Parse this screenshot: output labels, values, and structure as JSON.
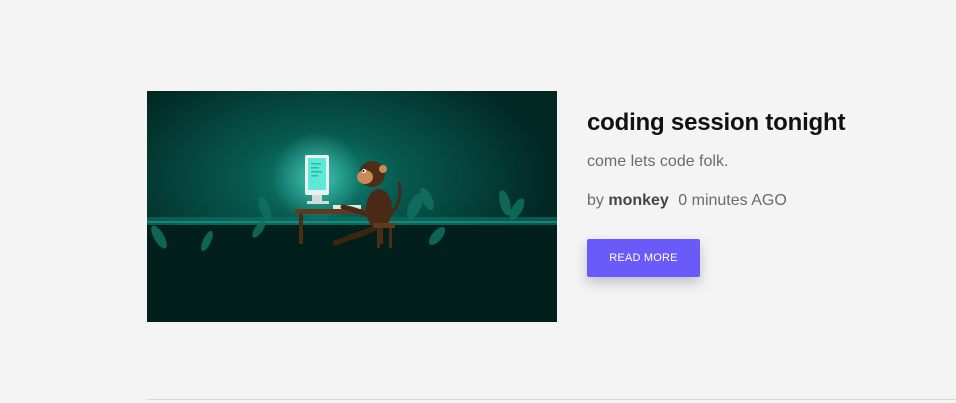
{
  "post": {
    "image_alt": "monkey coding at a computer illustration",
    "title": "coding session tonight",
    "excerpt": "come lets code folk.",
    "meta": {
      "by_label": "by",
      "author": "monkey",
      "time": "0 minutes AGO"
    },
    "read_more_label": "READ MORE"
  },
  "colors": {
    "background": "#f4f4f4",
    "accent_button": "#6a5af9",
    "title_text": "#111111",
    "body_text": "#6b6b6b",
    "image_bg": "#012a25"
  }
}
